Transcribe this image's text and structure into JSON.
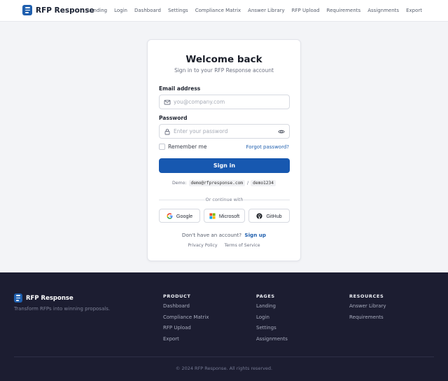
{
  "header": {
    "brand": "RFP Response",
    "nav": [
      "Landing",
      "Login",
      "Dashboard",
      "Settings",
      "Compliance Matrix",
      "Answer Library",
      "RFP Upload",
      "Requirements",
      "Assignments",
      "Export"
    ]
  },
  "login": {
    "title": "Welcome back",
    "subtitle": "Sign in to your RFP Response account",
    "email_label": "Email address",
    "email_placeholder": "you@company.com",
    "password_label": "Password",
    "password_placeholder": "Enter your password",
    "remember_label": "Remember me",
    "forgot_label": "Forgot password?",
    "signin_label": "Sign in",
    "demo_label": "Demo:",
    "demo_email": "demo@rfpresponse.com",
    "demo_sep": "/",
    "demo_password": "demo1234",
    "divider_text": "Or continue with",
    "social": [
      "Google",
      "Microsoft",
      "GitHub"
    ],
    "no_account_text": "Don't have an account?",
    "signup_label": "Sign up",
    "privacy_label": "Privacy Policy",
    "terms_label": "Terms of Service"
  },
  "footer": {
    "brand": "RFP Response",
    "tagline": "Transform RFPs into winning proposals.",
    "columns": [
      {
        "title": "PRODUCT",
        "links": [
          "Dashboard",
          "Compliance Matrix",
          "RFP Upload",
          "Export"
        ]
      },
      {
        "title": "PAGES",
        "links": [
          "Landing",
          "Login",
          "Settings",
          "Assignments"
        ]
      },
      {
        "title": "RESOURCES",
        "links": [
          "Answer Library",
          "Requirements"
        ]
      }
    ],
    "copyright": "© 2024 RFP Response. All rights reserved."
  },
  "colors": {
    "primary": "#1758b0",
    "link": "#1f5fae",
    "footer_bg": "#1c1d31",
    "page_bg": "#f3f4f7"
  },
  "icons": {
    "brand": "document-lines-icon",
    "email": "mail-icon",
    "password": "lock-icon",
    "toggle_password": "eye-icon",
    "social": [
      "google-icon",
      "microsoft-icon",
      "github-icon"
    ]
  }
}
